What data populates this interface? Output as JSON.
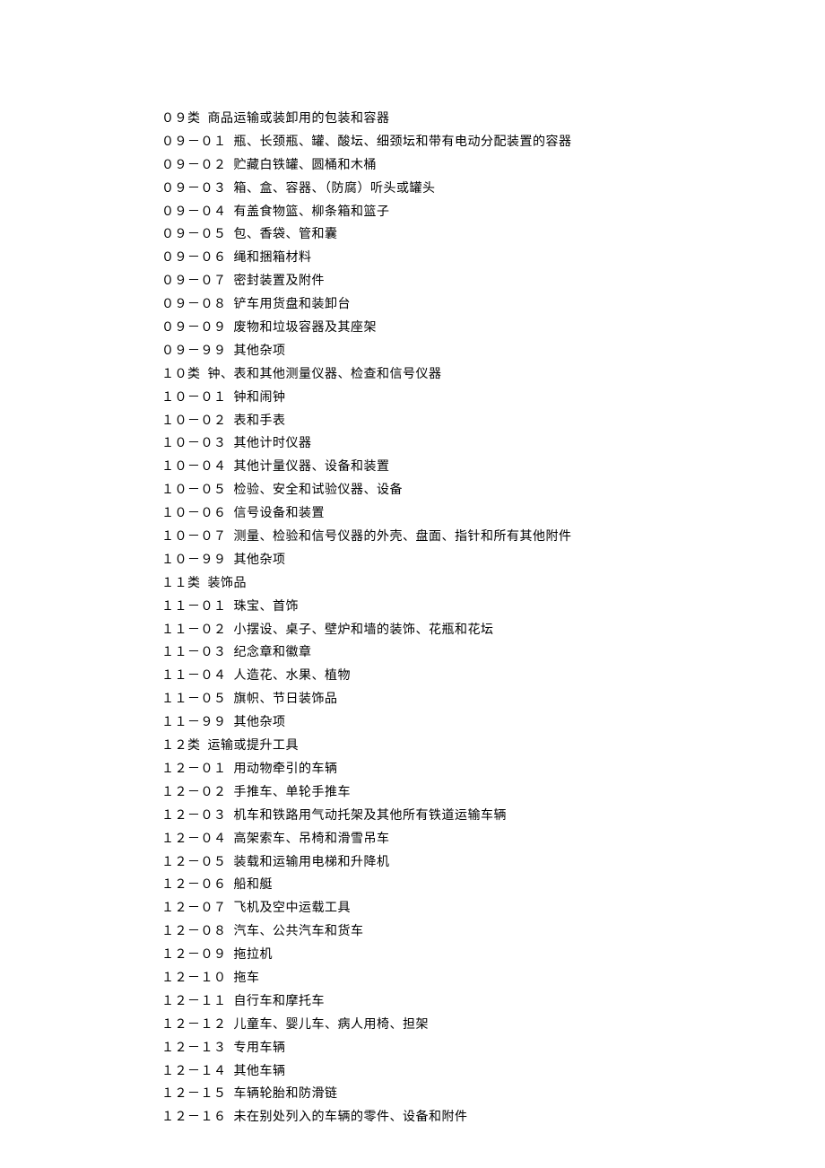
{
  "lines": [
    {
      "code": "０９类",
      "text": "商品运输或装卸用的包装和容器"
    },
    {
      "code": "０９－０１",
      "text": "瓶、长颈瓶、罐、酸坛、细颈坛和带有电动分配装置的容器"
    },
    {
      "code": "０９－０２",
      "text": "贮藏白铁罐、圆桶和木桶"
    },
    {
      "code": "０９－０３",
      "text": "箱、盒、容器、（防腐）听头或罐头"
    },
    {
      "code": "０９－０４",
      "text": "有盖食物篮、柳条箱和篮子"
    },
    {
      "code": "０９－０５",
      "text": "包、香袋、管和囊"
    },
    {
      "code": "０９－０６",
      "text": "绳和捆箱材料"
    },
    {
      "code": "０９－０７",
      "text": "密封装置及附件"
    },
    {
      "code": "０９－０８",
      "text": "铲车用货盘和装卸台"
    },
    {
      "code": "０９－０９",
      "text": "废物和垃圾容器及其座架"
    },
    {
      "code": "０９－９９",
      "text": "其他杂项"
    },
    {
      "code": "１０类",
      "text": "钟、表和其他测量仪器、检查和信号仪器"
    },
    {
      "code": "１０－０１",
      "text": "钟和闹钟"
    },
    {
      "code": "１０－０２",
      "text": "表和手表"
    },
    {
      "code": "１０－０３",
      "text": "其他计时仪器"
    },
    {
      "code": "１０－０４",
      "text": "其他计量仪器、设备和装置"
    },
    {
      "code": "１０－０５",
      "text": "检验、安全和试验仪器、设备"
    },
    {
      "code": "１０－０６",
      "text": "信号设备和装置"
    },
    {
      "code": "１０－０７",
      "text": "测量、检验和信号仪器的外壳、盘面、指针和所有其他附件"
    },
    {
      "code": "１０－９９",
      "text": "其他杂项"
    },
    {
      "code": "１１类",
      "text": "装饰品"
    },
    {
      "code": "１１－０１",
      "text": "珠宝、首饰"
    },
    {
      "code": "１１－０２",
      "text": "小摆设、桌子、壁炉和墙的装饰、花瓶和花坛"
    },
    {
      "code": "１１－０３",
      "text": "纪念章和徽章"
    },
    {
      "code": "１１－０４",
      "text": "人造花、水果、植物"
    },
    {
      "code": "１１－０５",
      "text": "旗帜、节日装饰品"
    },
    {
      "code": "１１－９９",
      "text": "其他杂项"
    },
    {
      "code": "１２类",
      "text": "运输或提升工具"
    },
    {
      "code": "１２－０１",
      "text": "用动物牵引的车辆"
    },
    {
      "code": "１２－０２",
      "text": "手推车、单轮手推车"
    },
    {
      "code": "１２－０３",
      "text": "机车和铁路用气动托架及其他所有铁道运输车辆"
    },
    {
      "code": "１２－０４",
      "text": "高架索车、吊椅和滑雪吊车"
    },
    {
      "code": "１２－０５",
      "text": "装载和运输用电梯和升降机"
    },
    {
      "code": "１２－０６",
      "text": "船和艇"
    },
    {
      "code": "１２－０７",
      "text": "飞机及空中运载工具"
    },
    {
      "code": "１２－０８",
      "text": "汽车、公共汽车和货车"
    },
    {
      "code": "１２－０９",
      "text": "拖拉机"
    },
    {
      "code": "１２－１０",
      "text": "拖车"
    },
    {
      "code": "１２－１１",
      "text": "自行车和摩托车"
    },
    {
      "code": "１２－１２",
      "text": "儿童车、婴儿车、病人用椅、担架"
    },
    {
      "code": "１２－１３",
      "text": "专用车辆"
    },
    {
      "code": "１２－１４",
      "text": "其他车辆"
    },
    {
      "code": "１２－１５",
      "text": "车辆轮胎和防滑链"
    },
    {
      "code": "１２－１６",
      "text": "未在别处列入的车辆的零件、设备和附件"
    }
  ]
}
